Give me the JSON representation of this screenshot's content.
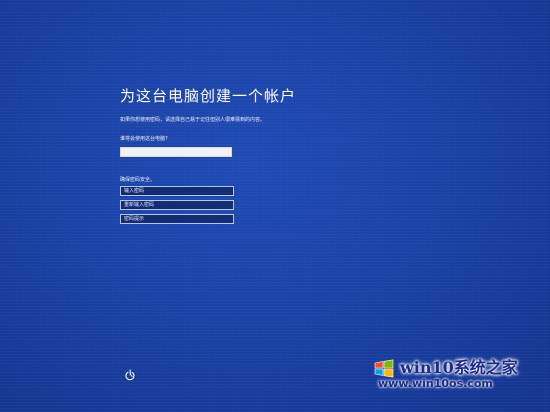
{
  "setup": {
    "title": "为这台电脑创建一个帐户",
    "subtitle": "如果你想使用密码，请选择自己易于记住但别人很难猜到的内容。",
    "user_label": "谁将会使用这台电脑?",
    "user_value": "",
    "secure_label": "确保密码安全。",
    "password_placeholder": "输入密码",
    "confirm_placeholder": "重新输入密码",
    "hint_placeholder": "密码提示"
  },
  "footer": {
    "power_icon": "power-icon"
  },
  "watermark": {
    "title": "win10系统之家",
    "url": "www.win10os.com"
  },
  "colors": {
    "background": "#1a42a8",
    "field_border": "#b7c6ea",
    "watermark_text": "#1d2a8a"
  }
}
